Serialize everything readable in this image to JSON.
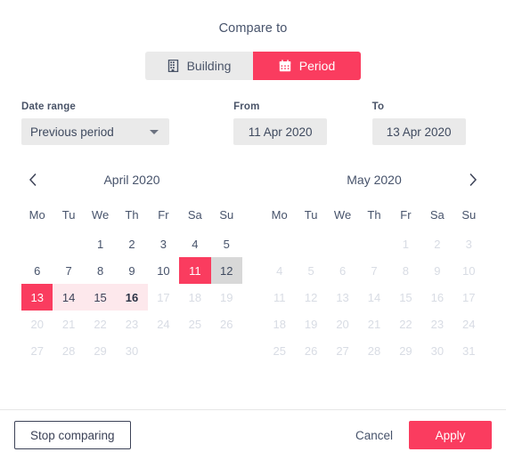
{
  "dialog": {
    "title": "Compare to"
  },
  "toggle": {
    "options": [
      {
        "label": "Building",
        "icon": "building-icon",
        "active": false
      },
      {
        "label": "Period",
        "icon": "calendar-icon",
        "active": true
      }
    ]
  },
  "fields": {
    "date_range": {
      "label": "Date range",
      "value": "Previous period"
    },
    "from": {
      "label": "From",
      "value": "11 Apr 2020"
    },
    "to": {
      "label": "To",
      "value": "13 Apr 2020"
    }
  },
  "calendars": {
    "weekdays": [
      "Mo",
      "Tu",
      "We",
      "Th",
      "Fr",
      "Sa",
      "Su"
    ],
    "prev_icon": "chevron-left-icon",
    "next_icon": "chevron-right-icon",
    "left": {
      "month": "April 2020",
      "lead_blanks": 2,
      "days": [
        {
          "n": 1,
          "state": "normal"
        },
        {
          "n": 2,
          "state": "normal"
        },
        {
          "n": 3,
          "state": "normal"
        },
        {
          "n": 4,
          "state": "normal"
        },
        {
          "n": 5,
          "state": "normal"
        },
        {
          "n": 6,
          "state": "normal"
        },
        {
          "n": 7,
          "state": "normal"
        },
        {
          "n": 8,
          "state": "normal"
        },
        {
          "n": 9,
          "state": "normal"
        },
        {
          "n": 10,
          "state": "normal"
        },
        {
          "n": 11,
          "state": "sel"
        },
        {
          "n": 12,
          "state": "graysel"
        },
        {
          "n": 13,
          "state": "sel"
        },
        {
          "n": 14,
          "state": "range"
        },
        {
          "n": 15,
          "state": "range"
        },
        {
          "n": 16,
          "state": "range today"
        },
        {
          "n": 17,
          "state": "disabled"
        },
        {
          "n": 18,
          "state": "disabled"
        },
        {
          "n": 19,
          "state": "disabled"
        },
        {
          "n": 20,
          "state": "disabled"
        },
        {
          "n": 21,
          "state": "disabled"
        },
        {
          "n": 22,
          "state": "disabled"
        },
        {
          "n": 23,
          "state": "disabled"
        },
        {
          "n": 24,
          "state": "disabled"
        },
        {
          "n": 25,
          "state": "disabled"
        },
        {
          "n": 26,
          "state": "disabled"
        },
        {
          "n": 27,
          "state": "disabled"
        },
        {
          "n": 28,
          "state": "disabled"
        },
        {
          "n": 29,
          "state": "disabled"
        },
        {
          "n": 30,
          "state": "disabled"
        }
      ]
    },
    "right": {
      "month": "May 2020",
      "lead_blanks": 4,
      "days": [
        {
          "n": 1,
          "state": "disabled"
        },
        {
          "n": 2,
          "state": "disabled"
        },
        {
          "n": 3,
          "state": "disabled"
        },
        {
          "n": 4,
          "state": "disabled"
        },
        {
          "n": 5,
          "state": "disabled"
        },
        {
          "n": 6,
          "state": "disabled"
        },
        {
          "n": 7,
          "state": "disabled"
        },
        {
          "n": 8,
          "state": "disabled"
        },
        {
          "n": 9,
          "state": "disabled"
        },
        {
          "n": 10,
          "state": "disabled"
        },
        {
          "n": 11,
          "state": "disabled"
        },
        {
          "n": 12,
          "state": "disabled"
        },
        {
          "n": 13,
          "state": "disabled"
        },
        {
          "n": 14,
          "state": "disabled"
        },
        {
          "n": 15,
          "state": "disabled"
        },
        {
          "n": 16,
          "state": "disabled"
        },
        {
          "n": 17,
          "state": "disabled"
        },
        {
          "n": 18,
          "state": "disabled"
        },
        {
          "n": 19,
          "state": "disabled"
        },
        {
          "n": 20,
          "state": "disabled"
        },
        {
          "n": 21,
          "state": "disabled"
        },
        {
          "n": 22,
          "state": "disabled"
        },
        {
          "n": 23,
          "state": "disabled"
        },
        {
          "n": 24,
          "state": "disabled"
        },
        {
          "n": 25,
          "state": "disabled"
        },
        {
          "n": 26,
          "state": "disabled"
        },
        {
          "n": 27,
          "state": "disabled"
        },
        {
          "n": 28,
          "state": "disabled"
        },
        {
          "n": 29,
          "state": "disabled"
        },
        {
          "n": 30,
          "state": "disabled"
        },
        {
          "n": 31,
          "state": "disabled"
        }
      ]
    }
  },
  "footer": {
    "stop_comparing": "Stop comparing",
    "cancel": "Cancel",
    "apply": "Apply"
  },
  "colors": {
    "accent": "#fa3c5f",
    "range_band": "#fde8ec",
    "gray_select": "#d8d8d8",
    "field_bg": "#eaeaea"
  }
}
